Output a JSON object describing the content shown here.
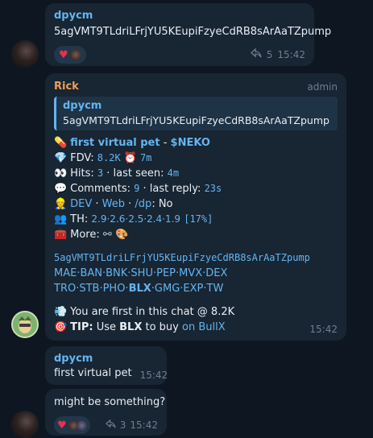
{
  "messages": {
    "m1": {
      "sender": "dpycm",
      "text": "5agVMT9TLdriLFrjYU5KEupiFzyeCdRB8sArAaTZpump",
      "reactions": [
        "heart-icon",
        "emoji-avatar"
      ],
      "forwards": "5",
      "time": "15:42"
    },
    "m2": {
      "sender": "Rick",
      "badge": "admin",
      "quote_sender": "dpycm",
      "quote_text": "5agVMT9TLdriLFrjYU5KEupiFzyeCdRB8sArAaTZpump",
      "token_name": "first virtual pet",
      "token_ticker": "$NEKO",
      "fdv_label": "FDV:",
      "fdv_value": "8.2K",
      "fdv_age": "7m",
      "hits_label": "Hits:",
      "hits_value": "3",
      "last_seen_label": "· last seen:",
      "last_seen_value": "4m",
      "comments_label": "Comments:",
      "comments_value": "9",
      "last_reply_label": "· last reply:",
      "last_reply_value": "23s",
      "dev_label": "DEV",
      "web_label": "Web",
      "dp_label": "/dp",
      "dp_value": "No",
      "sep1": " · ",
      "sep2": " · ",
      "sep3": ": ",
      "th_label": "TH:",
      "th_values": "2.9·2.6·2.5·2.4·1.9",
      "th_total": "[17%]",
      "more_label": "More:",
      "address": "5agVMT9TLdriLFrjYU5KEupiFzyeCdRB8sArAaTZpump",
      "platforms_row1": "MAE·BAN·BNK·SHU·PEP·MVX·DEX",
      "platforms_row2_a": "TRO·STB·PHO·",
      "platforms_row2_b": "BLX",
      "platforms_row2_c": "·GMG·EXP·TW",
      "first_text": "You are first in this chat @ 8.2K",
      "tip_label": "TIP:",
      "tip_text_a": " Use ",
      "tip_blx": "BLX",
      "tip_text_b": " to buy ",
      "tip_link": "on BullX",
      "time": "15:42"
    },
    "m3": {
      "sender": "dpycm",
      "text": "first virtual pet",
      "time": "15:42"
    },
    "m4": {
      "text": "might be something?",
      "reactions": [
        "heart-icon",
        "emoji-avatar",
        "emoji-avatar-2"
      ],
      "forwards": "3",
      "time": "15:42"
    }
  },
  "colors": {
    "background": "#0e1621",
    "bubble": "#182533",
    "accent": "#64b5ef",
    "rick": "#ef9d55"
  }
}
